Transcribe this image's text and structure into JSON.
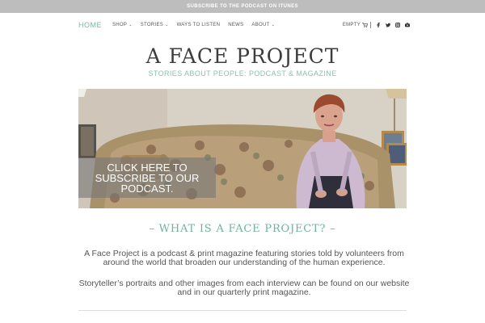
{
  "topbar": {
    "label": "SUBSCRIBE TO THE PODCAST ON ITUNES"
  },
  "nav": {
    "home": "HOME",
    "items": [
      {
        "label": "SHOP",
        "dropdown": true
      },
      {
        "label": "STORIES",
        "dropdown": true
      },
      {
        "label": "WAYS TO LISTEN",
        "dropdown": false
      },
      {
        "label": "NEWS",
        "dropdown": false
      },
      {
        "label": "ABOUT",
        "dropdown": true
      }
    ],
    "cart_label": "EMPTY",
    "social_icons": [
      "facebook-icon",
      "twitter-icon",
      "instagram-icon",
      "youtube-icon"
    ]
  },
  "site": {
    "title": "A FACE PROJECT",
    "tagline": "STORIES ABOUT PEOPLE: PODCAST & MAGAZINE"
  },
  "hero": {
    "cta_label": "CLICK HERE TO SUBSCRIBE TO OUR PODCAST."
  },
  "section": {
    "heading": "– WHAT IS A FACE PROJECT? –",
    "paragraph_1": "A Face Project is a podcast & print magazine featuring stories told by volunteers from around the world that broaden our understanding of the human experience.",
    "paragraph_2": "Storyteller’s portraits and other images from each interview can be found on our website and in our quarterly print magazine."
  },
  "colors": {
    "accent": "#7cb8a7",
    "topbar": "#bdbdbd",
    "text": "#444444"
  }
}
